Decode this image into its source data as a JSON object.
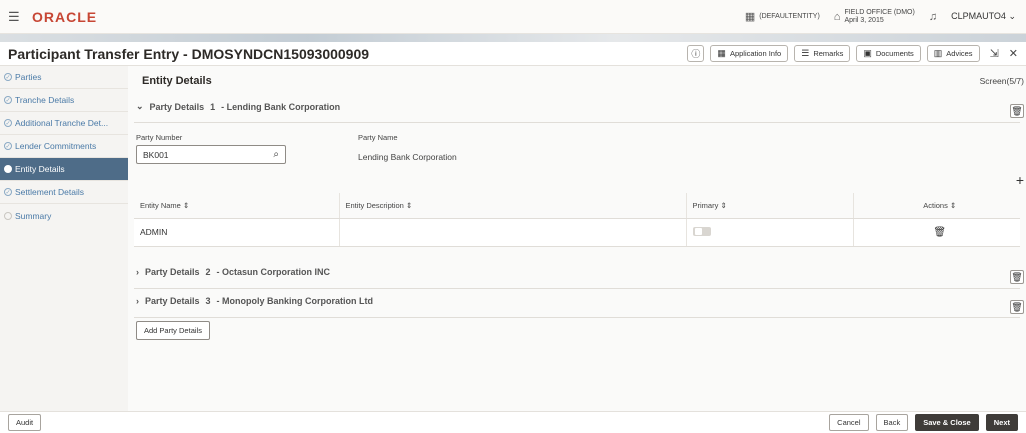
{
  "header": {
    "logo": "ORACLE",
    "entity": "(DEFAULTENTITY)",
    "office_name": "FIELD OFFICE (DMO)",
    "office_date": "April 3, 2015",
    "user": "CLPMAUTO4"
  },
  "title": {
    "text": "Participant Transfer Entry - DMOSYNDCN15093000909",
    "buttons": {
      "app_info": "Application Info",
      "remarks": "Remarks",
      "documents": "Documents",
      "advices": "Advices"
    }
  },
  "sidebar": {
    "items": [
      {
        "label": "Parties"
      },
      {
        "label": "Tranche Details"
      },
      {
        "label": "Additional Tranche Det..."
      },
      {
        "label": "Lender Commitments"
      },
      {
        "label": "Entity Details"
      },
      {
        "label": "Settlement Details"
      },
      {
        "label": "Summary"
      }
    ],
    "active_index": 4
  },
  "main": {
    "section_title": "Entity Details",
    "screen_indicator": "Screen(5/7)",
    "party1": {
      "number_label": "1",
      "name": "- Lending Bank Corporation",
      "heading": "Party Details",
      "party_number_label": "Party Number",
      "party_number_value": "BK001",
      "party_name_label": "Party Name",
      "party_name_value": "Lending Bank Corporation"
    },
    "table": {
      "columns": [
        "Entity Name",
        "Entity Description",
        "Primary",
        "Actions"
      ],
      "rows": [
        {
          "entity_name": "ADMIN",
          "entity_description": "",
          "primary": false
        }
      ]
    },
    "party2": {
      "heading": "Party Details",
      "number_label": "2",
      "name": "- Octasun Corporation INC"
    },
    "party3": {
      "heading": "Party Details",
      "number_label": "3",
      "name": "- Monopoly Banking Corporation Ltd"
    },
    "add_party_label": "Add Party Details"
  },
  "footer": {
    "audit": "Audit",
    "cancel": "Cancel",
    "back": "Back",
    "save_close": "Save & Close",
    "next": "Next"
  },
  "colors": {
    "accent": "#c74634",
    "sidebar_active": "#4e6c88",
    "link": "#4a7aa7",
    "dark_button": "#3f3c39"
  }
}
